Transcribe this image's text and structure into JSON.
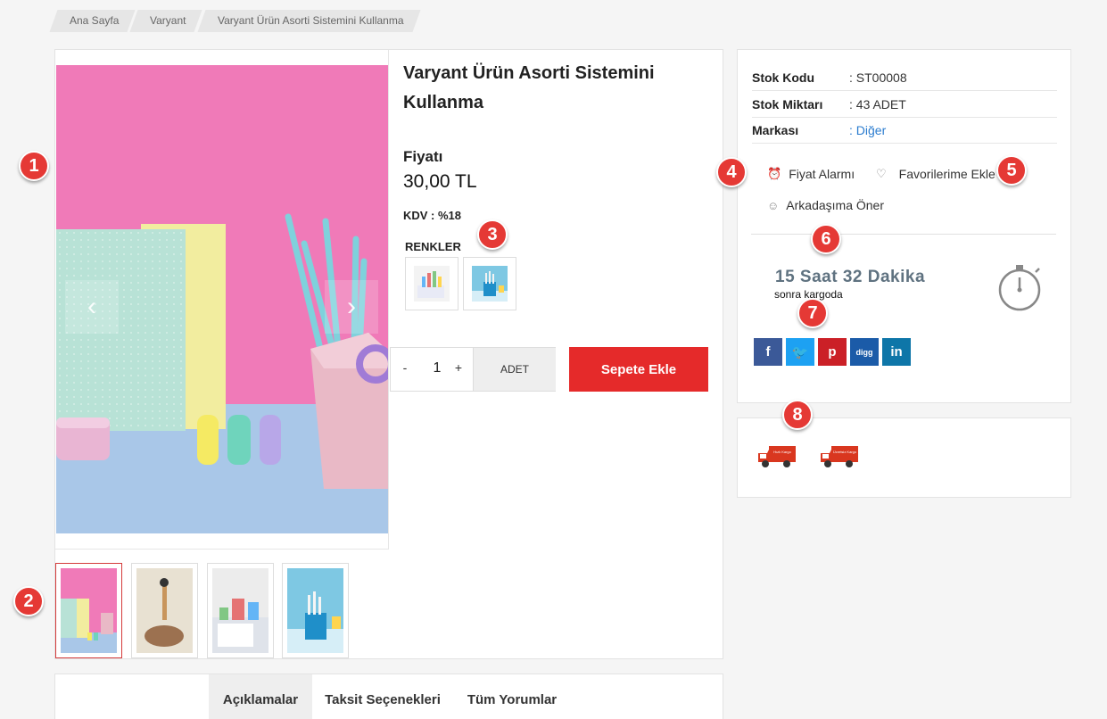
{
  "breadcrumb": [
    "Ana Sayfa",
    "Varyant",
    "Varyant Ürün Asorti Sistemini Kullanma"
  ],
  "product": {
    "title": "Varyant Ürün Asorti Sistemini Kullanma",
    "price_label": "Fiyatı",
    "price": "30,00 TL",
    "kdv": "KDV : %18",
    "colors_label": "RENKLER",
    "quantity": "1",
    "qty_minus": "-",
    "qty_plus": "+",
    "unit": "ADET",
    "add_to_cart": "Sepete Ekle"
  },
  "info": [
    {
      "key": "Stok Kodu",
      "value": ": ST00008"
    },
    {
      "key": "Stok Miktarı",
      "value": ": 43 ADET"
    },
    {
      "key": "Markası",
      "value": ": Diğer"
    }
  ],
  "actions": {
    "price_alarm": "Fiyat Alarmı",
    "favorites": "Favorilerime Ekle",
    "recommend": "Arkadaşıma Öner"
  },
  "cargo": {
    "time": "15 Saat 32 Dakika",
    "sub": "sonra kargoda"
  },
  "social": [
    "f",
    "t",
    "p",
    "digg",
    "in"
  ],
  "trucks": [
    "Hızlı Kargo",
    "Ücretsiz Kargo"
  ],
  "tabs": [
    "Açıklamalar",
    "Taksit Seçenekleri",
    "Tüm Yorumlar"
  ],
  "badges": [
    "1",
    "2",
    "3",
    "4",
    "5",
    "6",
    "7",
    "8"
  ],
  "colors": {
    "accent": "#e52a2a",
    "link": "#2b7ccf",
    "badge": "#e53935"
  }
}
